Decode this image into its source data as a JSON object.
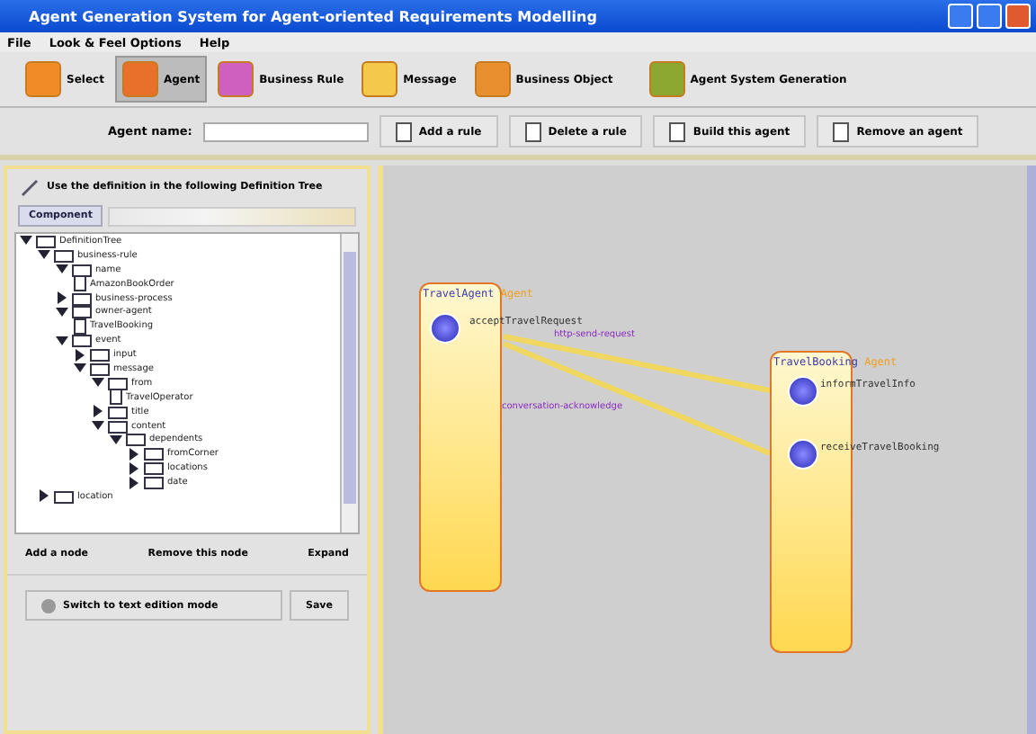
{
  "window": {
    "title": "Agent Generation System for Agent-oriented Requirements Modelling"
  },
  "menu": [
    "File",
    "Look & Feel Options",
    "Help"
  ],
  "toolbar": [
    {
      "label": "Select",
      "kind": "select",
      "selected": false
    },
    {
      "label": "Agent",
      "kind": "agent",
      "selected": true
    },
    {
      "label": "Business Rule",
      "kind": "rule",
      "selected": false
    },
    {
      "label": "Message",
      "kind": "message",
      "selected": false
    },
    {
      "label": "Business Object",
      "kind": "object",
      "selected": false
    },
    {
      "label": "Agent System Generation",
      "kind": "generate",
      "selected": false
    }
  ],
  "agent_bar": {
    "label": "Agent name:",
    "buttons": [
      "Add a rule",
      "Delete a rule",
      "Build this agent",
      "Remove an agent"
    ]
  },
  "definition_panel": {
    "heading": "Use the definition in the following Definition Tree",
    "component_button": "Component",
    "tree": [
      {
        "label": "DefinitionTree",
        "kind": "folder",
        "expanded": true,
        "children": [
          {
            "label": "business-rule",
            "kind": "folder",
            "expanded": true,
            "children": [
              {
                "label": "name",
                "kind": "folder",
                "expanded": true,
                "children": [
                  {
                    "label": "AmazonBookOrder",
                    "kind": "leaf"
                  }
                ]
              },
              {
                "label": "business-process",
                "kind": "folder",
                "expanded": false
              },
              {
                "label": "owner-agent",
                "kind": "folder",
                "expanded": true,
                "children": [
                  {
                    "label": "TravelBooking",
                    "kind": "leaf"
                  }
                ]
              },
              {
                "label": "event",
                "kind": "folder",
                "expanded": true,
                "children": [
                  {
                    "label": "input",
                    "kind": "folder",
                    "expanded": false
                  },
                  {
                    "label": "message",
                    "kind": "folder",
                    "expanded": true,
                    "children": [
                      {
                        "label": "from",
                        "kind": "folder",
                        "expanded": true,
                        "children": [
                          {
                            "label": "TravelOperator",
                            "kind": "leaf"
                          }
                        ]
                      },
                      {
                        "label": "title",
                        "kind": "folder",
                        "expanded": false
                      },
                      {
                        "label": "content",
                        "kind": "folder",
                        "expanded": true,
                        "children": [
                          {
                            "label": "dependents",
                            "kind": "folder",
                            "expanded": true,
                            "children": [
                              {
                                "label": "fromCorner",
                                "kind": "folder",
                                "expanded": false
                              },
                              {
                                "label": "locations",
                                "kind": "folder",
                                "expanded": false
                              },
                              {
                                "label": "date",
                                "kind": "folder",
                                "expanded": false
                              }
                            ]
                          }
                        ]
                      }
                    ]
                  }
                ]
              }
            ]
          },
          {
            "label": "location",
            "kind": "folder",
            "expanded": false
          }
        ]
      }
    ],
    "node_buttons": [
      "Add a node",
      "Remove this node",
      "Expand"
    ],
    "bottom_buttons": [
      "Switch to text edition mode",
      "Save"
    ]
  },
  "diagram": {
    "agents": [
      {
        "name": "TravelAgent",
        "tag": "Agent",
        "ports": [
          {
            "label": "acceptTravelRequest"
          }
        ]
      },
      {
        "name": "TravelBooking",
        "tag": "Agent",
        "ports": [
          {
            "label": "informTravelInfo"
          },
          {
            "label": "receiveTravelBooking"
          }
        ]
      }
    ],
    "links": [
      {
        "label": "http-send-request"
      },
      {
        "label": "conversation-acknowledge"
      }
    ]
  }
}
